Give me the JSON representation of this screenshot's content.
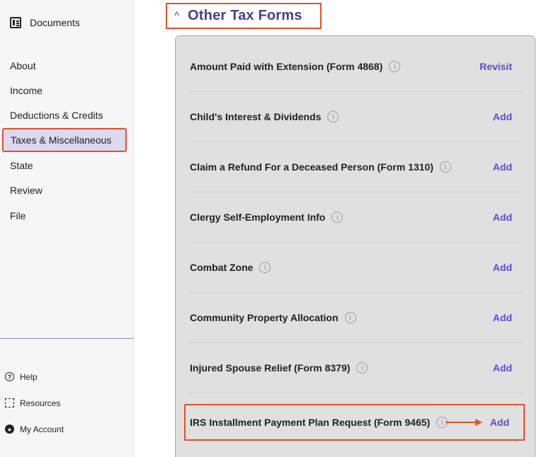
{
  "sidebar": {
    "documents_label": "Documents",
    "nav": [
      {
        "label": "About"
      },
      {
        "label": "Income"
      },
      {
        "label": "Deductions & Credits"
      },
      {
        "label": "Taxes & Miscellaneous"
      },
      {
        "label": "State"
      },
      {
        "label": "Review"
      },
      {
        "label": "File"
      }
    ],
    "bottom": [
      {
        "label": "Help"
      },
      {
        "label": "Resources"
      },
      {
        "label": "My Account"
      }
    ]
  },
  "section": {
    "title": "Other Tax Forms",
    "chevron": "^"
  },
  "forms": [
    {
      "label": "Amount Paid with Extension (Form 4868)",
      "action": "Revisit"
    },
    {
      "label": "Child's Interest & Dividends",
      "action": "Add"
    },
    {
      "label": "Claim a Refund For a Deceased Person (Form 1310)",
      "action": "Add"
    },
    {
      "label": "Clergy Self-Employment Info",
      "action": "Add"
    },
    {
      "label": "Combat Zone",
      "action": "Add"
    },
    {
      "label": "Community Property Allocation",
      "action": "Add"
    },
    {
      "label": "Injured Spouse Relief (Form 8379)",
      "action": "Add"
    },
    {
      "label": "IRS Installment Payment Plan Request (Form 9465)",
      "action": "Add"
    }
  ],
  "info_glyph": "i",
  "colors": {
    "accent": "#5b4bd6",
    "heading": "#4a3f8c",
    "highlight_border": "#e0502c",
    "active_nav_bg": "#ddd7ef"
  }
}
